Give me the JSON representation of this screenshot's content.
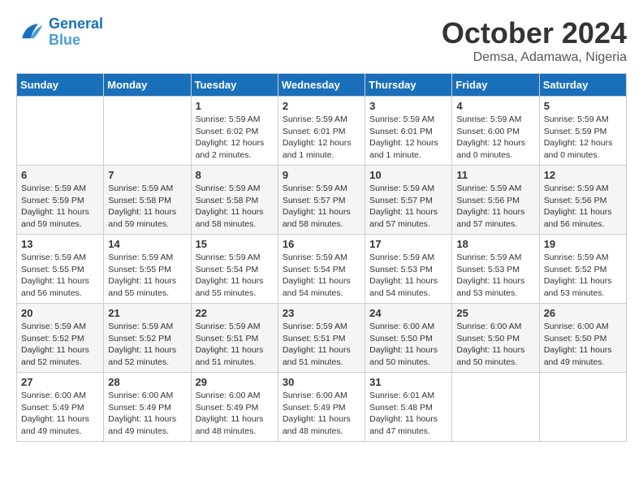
{
  "header": {
    "logo_line1": "General",
    "logo_line2": "Blue",
    "month": "October 2024",
    "location": "Demsa, Adamawa, Nigeria"
  },
  "days_of_week": [
    "Sunday",
    "Monday",
    "Tuesday",
    "Wednesday",
    "Thursday",
    "Friday",
    "Saturday"
  ],
  "weeks": [
    [
      {
        "day": "",
        "info": ""
      },
      {
        "day": "",
        "info": ""
      },
      {
        "day": "1",
        "info": "Sunrise: 5:59 AM\nSunset: 6:02 PM\nDaylight: 12 hours\nand 2 minutes."
      },
      {
        "day": "2",
        "info": "Sunrise: 5:59 AM\nSunset: 6:01 PM\nDaylight: 12 hours\nand 1 minute."
      },
      {
        "day": "3",
        "info": "Sunrise: 5:59 AM\nSunset: 6:01 PM\nDaylight: 12 hours\nand 1 minute."
      },
      {
        "day": "4",
        "info": "Sunrise: 5:59 AM\nSunset: 6:00 PM\nDaylight: 12 hours\nand 0 minutes."
      },
      {
        "day": "5",
        "info": "Sunrise: 5:59 AM\nSunset: 5:59 PM\nDaylight: 12 hours\nand 0 minutes."
      }
    ],
    [
      {
        "day": "6",
        "info": "Sunrise: 5:59 AM\nSunset: 5:59 PM\nDaylight: 11 hours\nand 59 minutes."
      },
      {
        "day": "7",
        "info": "Sunrise: 5:59 AM\nSunset: 5:58 PM\nDaylight: 11 hours\nand 59 minutes."
      },
      {
        "day": "8",
        "info": "Sunrise: 5:59 AM\nSunset: 5:58 PM\nDaylight: 11 hours\nand 58 minutes."
      },
      {
        "day": "9",
        "info": "Sunrise: 5:59 AM\nSunset: 5:57 PM\nDaylight: 11 hours\nand 58 minutes."
      },
      {
        "day": "10",
        "info": "Sunrise: 5:59 AM\nSunset: 5:57 PM\nDaylight: 11 hours\nand 57 minutes."
      },
      {
        "day": "11",
        "info": "Sunrise: 5:59 AM\nSunset: 5:56 PM\nDaylight: 11 hours\nand 57 minutes."
      },
      {
        "day": "12",
        "info": "Sunrise: 5:59 AM\nSunset: 5:56 PM\nDaylight: 11 hours\nand 56 minutes."
      }
    ],
    [
      {
        "day": "13",
        "info": "Sunrise: 5:59 AM\nSunset: 5:55 PM\nDaylight: 11 hours\nand 56 minutes."
      },
      {
        "day": "14",
        "info": "Sunrise: 5:59 AM\nSunset: 5:55 PM\nDaylight: 11 hours\nand 55 minutes."
      },
      {
        "day": "15",
        "info": "Sunrise: 5:59 AM\nSunset: 5:54 PM\nDaylight: 11 hours\nand 55 minutes."
      },
      {
        "day": "16",
        "info": "Sunrise: 5:59 AM\nSunset: 5:54 PM\nDaylight: 11 hours\nand 54 minutes."
      },
      {
        "day": "17",
        "info": "Sunrise: 5:59 AM\nSunset: 5:53 PM\nDaylight: 11 hours\nand 54 minutes."
      },
      {
        "day": "18",
        "info": "Sunrise: 5:59 AM\nSunset: 5:53 PM\nDaylight: 11 hours\nand 53 minutes."
      },
      {
        "day": "19",
        "info": "Sunrise: 5:59 AM\nSunset: 5:52 PM\nDaylight: 11 hours\nand 53 minutes."
      }
    ],
    [
      {
        "day": "20",
        "info": "Sunrise: 5:59 AM\nSunset: 5:52 PM\nDaylight: 11 hours\nand 52 minutes."
      },
      {
        "day": "21",
        "info": "Sunrise: 5:59 AM\nSunset: 5:52 PM\nDaylight: 11 hours\nand 52 minutes."
      },
      {
        "day": "22",
        "info": "Sunrise: 5:59 AM\nSunset: 5:51 PM\nDaylight: 11 hours\nand 51 minutes."
      },
      {
        "day": "23",
        "info": "Sunrise: 5:59 AM\nSunset: 5:51 PM\nDaylight: 11 hours\nand 51 minutes."
      },
      {
        "day": "24",
        "info": "Sunrise: 6:00 AM\nSunset: 5:50 PM\nDaylight: 11 hours\nand 50 minutes."
      },
      {
        "day": "25",
        "info": "Sunrise: 6:00 AM\nSunset: 5:50 PM\nDaylight: 11 hours\nand 50 minutes."
      },
      {
        "day": "26",
        "info": "Sunrise: 6:00 AM\nSunset: 5:50 PM\nDaylight: 11 hours\nand 49 minutes."
      }
    ],
    [
      {
        "day": "27",
        "info": "Sunrise: 6:00 AM\nSunset: 5:49 PM\nDaylight: 11 hours\nand 49 minutes."
      },
      {
        "day": "28",
        "info": "Sunrise: 6:00 AM\nSunset: 5:49 PM\nDaylight: 11 hours\nand 49 minutes."
      },
      {
        "day": "29",
        "info": "Sunrise: 6:00 AM\nSunset: 5:49 PM\nDaylight: 11 hours\nand 48 minutes."
      },
      {
        "day": "30",
        "info": "Sunrise: 6:00 AM\nSunset: 5:49 PM\nDaylight: 11 hours\nand 48 minutes."
      },
      {
        "day": "31",
        "info": "Sunrise: 6:01 AM\nSunset: 5:48 PM\nDaylight: 11 hours\nand 47 minutes."
      },
      {
        "day": "",
        "info": ""
      },
      {
        "day": "",
        "info": ""
      }
    ]
  ]
}
